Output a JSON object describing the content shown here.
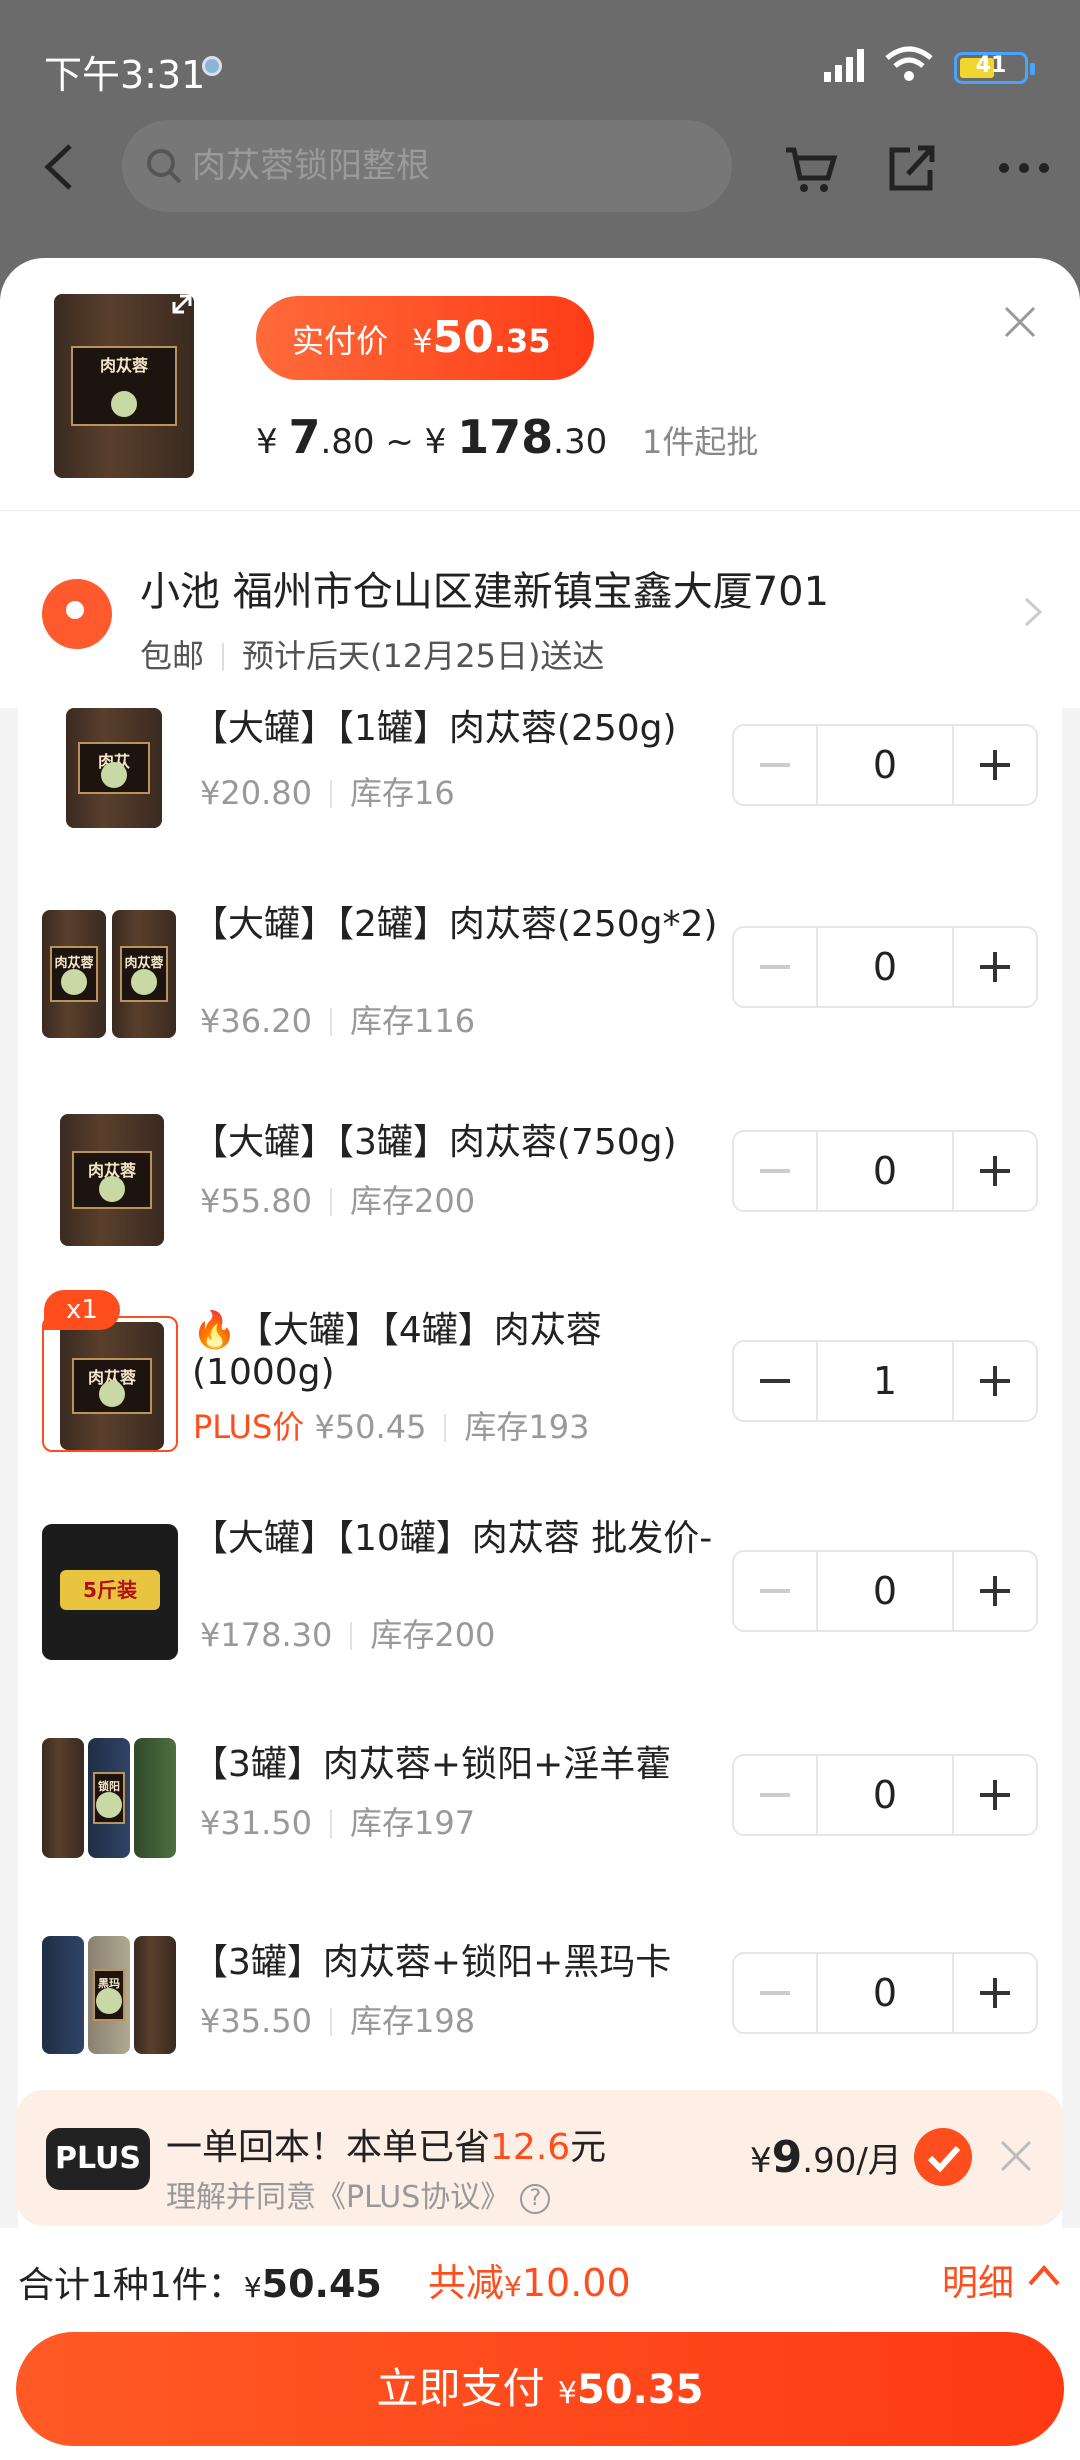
{
  "status_bar": {
    "time": "下午3:31",
    "battery": "41"
  },
  "top_bar": {
    "search_placeholder": "肉苁蓉锁阳整根"
  },
  "header": {
    "pay_label": "实付价",
    "pay_currency": "¥",
    "pay_int": "50",
    "pay_dec": ".35",
    "range_prefix": "¥",
    "range_low_int": "7",
    "range_low_dec": ".80",
    "range_sep": " ~ ¥",
    "range_high_int": "178",
    "range_high_dec": ".30",
    "moq": "1件起批",
    "thumb_label": "肉苁蓉"
  },
  "address": {
    "line": "小池 福州市仓山区建新镇宝鑫大厦701",
    "shipping": "包邮",
    "delivery": "预计后天(12月25日)送达"
  },
  "items": [
    {
      "name": "【大罐】【1罐】肉苁蓉(250g)",
      "price": "¥20.80",
      "stock": "库存16",
      "qty": "0",
      "img_label": "肉苁"
    },
    {
      "name": "【大罐】【2罐】肉苁蓉(250g*2)",
      "price": "¥36.20",
      "stock": "库存116",
      "qty": "0",
      "img_label": "肉苁蓉"
    },
    {
      "name": "【大罐】【3罐】肉苁蓉(750g)",
      "price": "¥55.80",
      "stock": "库存200",
      "qty": "0",
      "img_label": "肉苁蓉"
    },
    {
      "name": "🔥【大罐】【4罐】肉苁蓉(1000g)",
      "plus_label": "PLUS价",
      "price": "¥50.45",
      "stock": "库存193",
      "qty": "1",
      "badge": "x1",
      "img_label": "肉苁蓉"
    },
    {
      "name": "【大罐】【10罐】肉苁蓉 批发价-",
      "price": "¥178.30",
      "stock": "库存200",
      "qty": "0",
      "img_label": "5斤装"
    },
    {
      "name": "【3罐】肉苁蓉+锁阳+淫羊藿",
      "price": "¥31.50",
      "stock": "库存197",
      "qty": "0",
      "img_label": "锁阳"
    },
    {
      "name": "【3罐】肉苁蓉+锁阳+黑玛卡",
      "price": "¥35.50",
      "stock": "库存198",
      "qty": "0",
      "img_label": "黑玛卡"
    }
  ],
  "plus_bar": {
    "logo": "PLUS",
    "line1_a": "一单回本！本单已省",
    "line1_amount": "12.6",
    "line1_b": "元",
    "line2": "理解并同意《PLUS协议》",
    "price_prefix": "¥",
    "price_int": "9",
    "price_dec": ".90",
    "price_unit": "/月"
  },
  "footer": {
    "summary_label": "合计1种1件：",
    "summary_currency": "¥",
    "summary_value": "50.45",
    "discount_label": "共减",
    "discount_currency": "¥",
    "discount_value": "10.00",
    "detail": "明细",
    "buy_label": "立即支付",
    "buy_currency": "¥",
    "buy_value": "50.35"
  },
  "colors": {
    "accent": "#fe4e1e",
    "overlay": "#6b6b6b"
  }
}
